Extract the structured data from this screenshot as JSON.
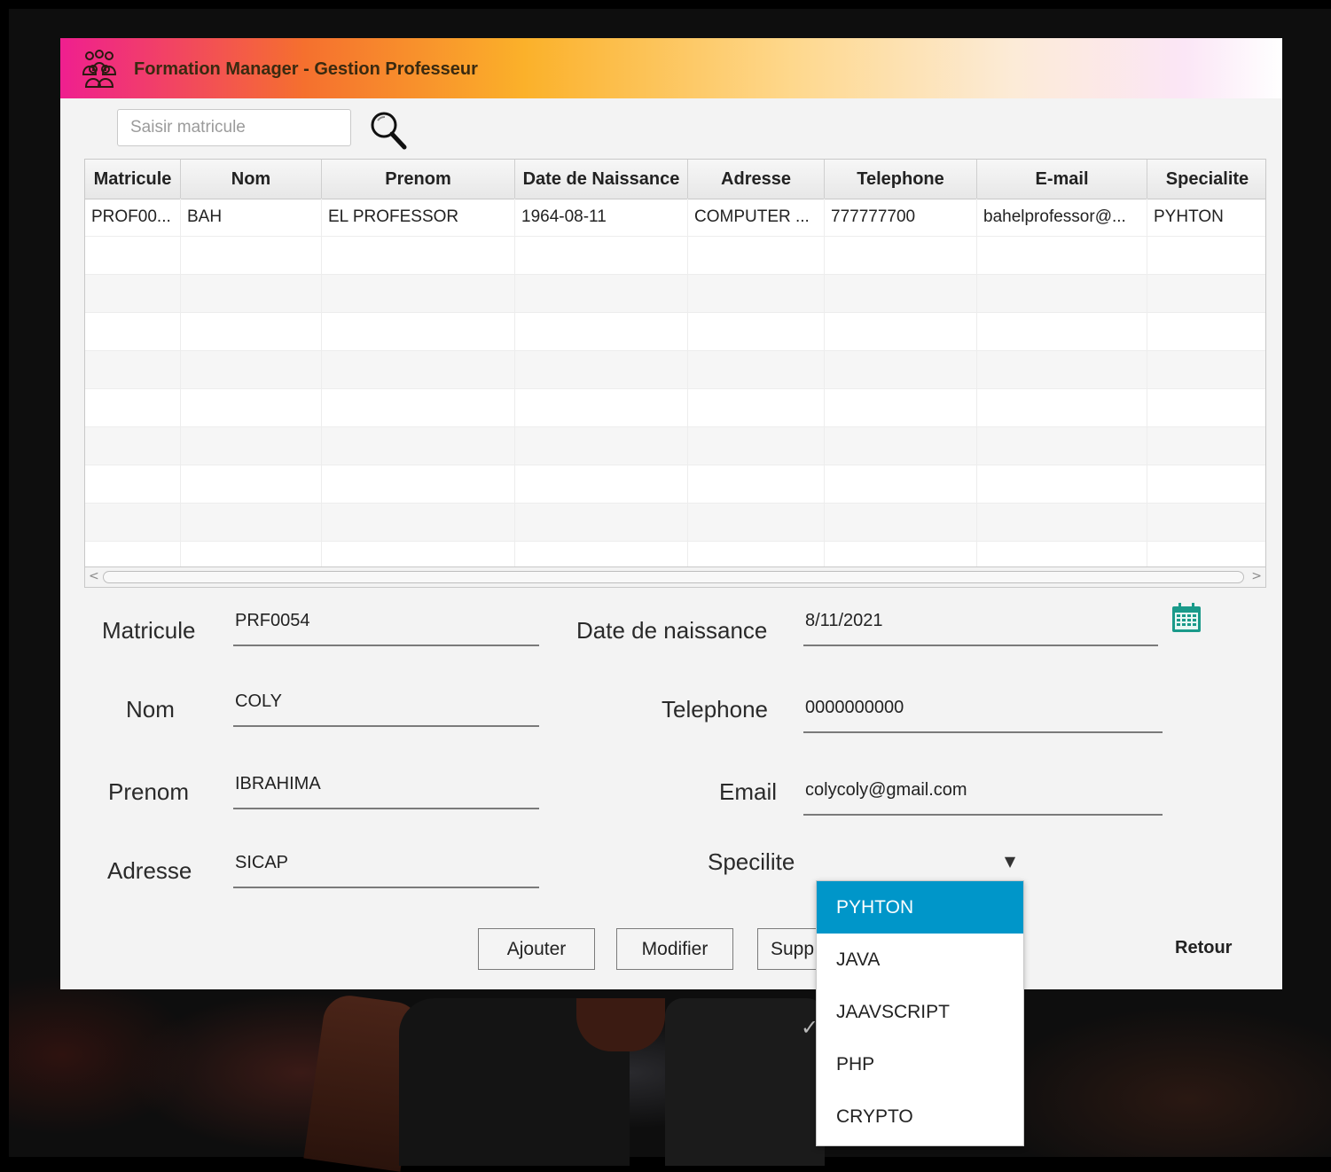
{
  "window": {
    "title": "Formation Manager - Gestion Professeur"
  },
  "search": {
    "placeholder": "Saisir matricule",
    "value": ""
  },
  "table": {
    "columns": [
      "Matricule",
      "Nom",
      "Prenom",
      "Date de Naissance",
      "Adresse",
      "Telephone",
      "E-mail",
      "Specialite"
    ],
    "rows": [
      [
        "PROF00...",
        "BAH",
        "EL PROFESSOR",
        "1964-08-11",
        "COMPUTER ...",
        "777777700",
        "bahelprofessor@...",
        "PYHTON"
      ]
    ]
  },
  "form": {
    "matricule": {
      "label": "Matricule",
      "value": "PRF0054"
    },
    "nom": {
      "label": "Nom",
      "value": "COLY"
    },
    "prenom": {
      "label": "Prenom",
      "value": "IBRAHIMA"
    },
    "adresse": {
      "label": "Adresse",
      "value": "SICAP"
    },
    "date_naissance": {
      "label": "Date de naissance",
      "value": "8/11/2021"
    },
    "telephone": {
      "label": "Telephone",
      "value": "0000000000"
    },
    "email": {
      "label": "Email",
      "value": "colycoly@gmail.com"
    },
    "specialite": {
      "label": "Specilite",
      "value": ""
    }
  },
  "buttons": {
    "ajouter": "Ajouter",
    "modifier": "Modifier",
    "supprimer": "Supp",
    "retour": "Retour"
  },
  "dropdown": {
    "options": [
      "PYHTON",
      "JAVA",
      "JAAVSCRIPT",
      "PHP",
      "CRYPTO"
    ],
    "highlighted": "PYHTON"
  },
  "icons": {
    "app": "people-group-icon",
    "search": "magnifier-icon",
    "calendar": "calendar-icon",
    "combo": "chevron-down-icon"
  },
  "colors": {
    "selection": "#0096c9",
    "calendar": "#1a9a8a",
    "title_gradient_start": "#ef1f8f",
    "title_gradient_mid": "#fbb12a"
  }
}
